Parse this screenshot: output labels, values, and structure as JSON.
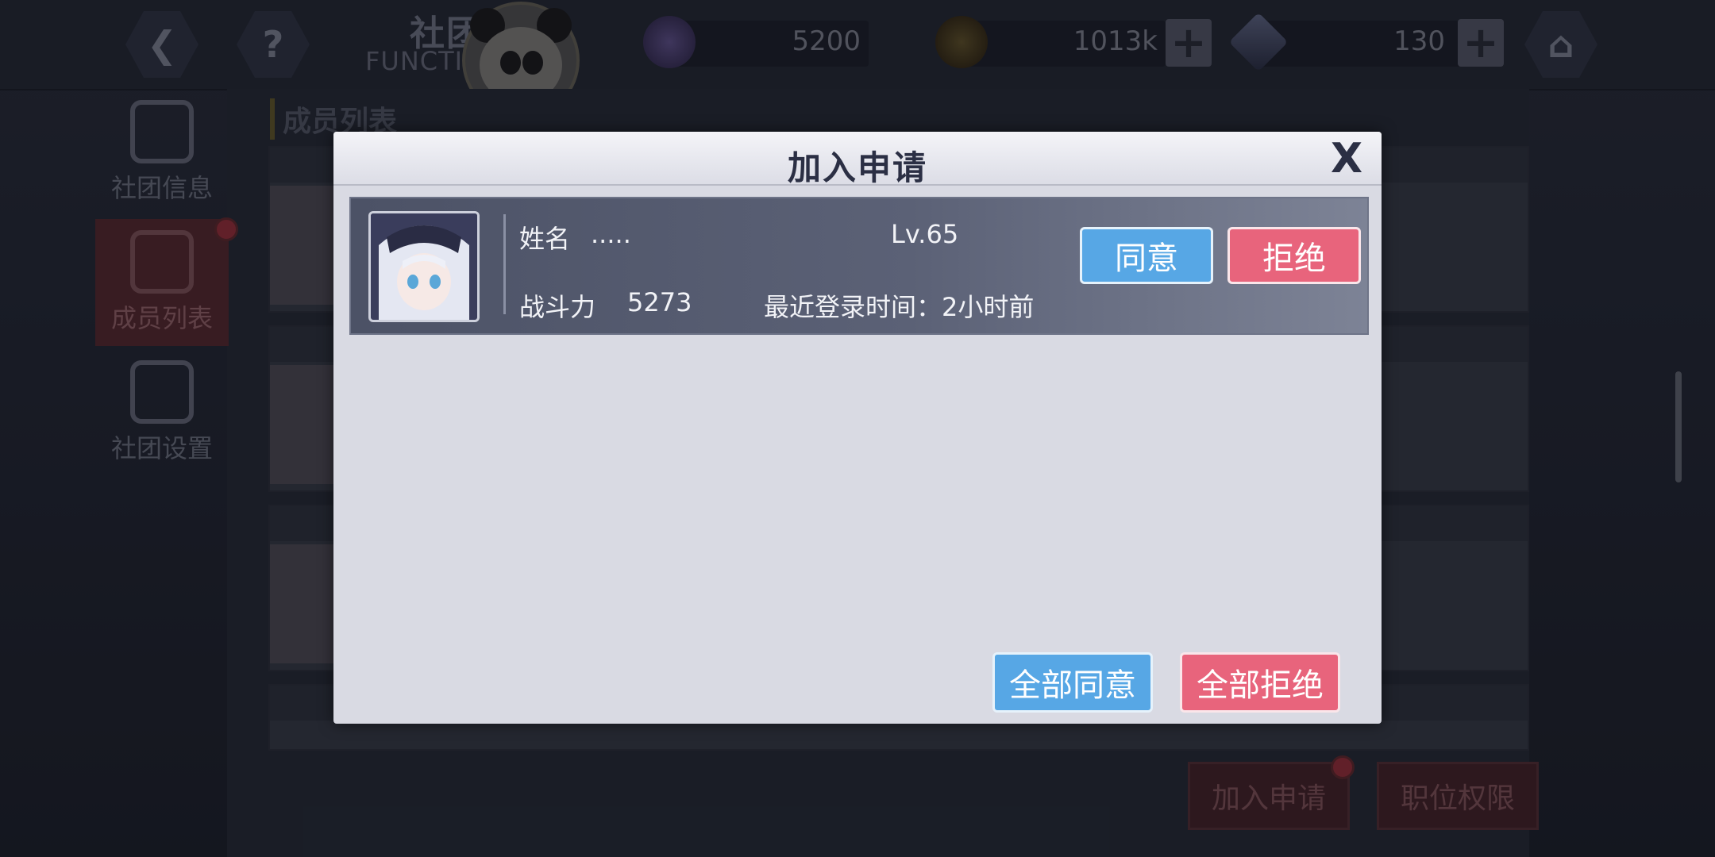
{
  "topbar": {
    "club_title": "社团",
    "club_subtitle": "FUNCTIONAL",
    "back_icon": "back-arrow-icon",
    "help_icon": "question-icon",
    "home_icon": "home-icon",
    "currencies": [
      {
        "name": "token-icon",
        "value": "5200"
      },
      {
        "name": "gold-coin-icon",
        "value": "1013k"
      },
      {
        "name": "crystal-icon",
        "value": "130"
      }
    ]
  },
  "sidebar": {
    "items": [
      {
        "label": "社团信息"
      },
      {
        "label": "成员列表"
      },
      {
        "label": "社团设置"
      }
    ]
  },
  "content": {
    "section_title": "成员列表",
    "bottom_buttons": {
      "join_requests": "加入申请",
      "permissions": "职位权限"
    }
  },
  "modal": {
    "title": "加入申请",
    "close_label": "X",
    "request": {
      "name_label": "姓名",
      "name_value": ".....",
      "level": "Lv.65",
      "power_label": "战斗力",
      "power_value": "5273",
      "last_login": "最近登录时间：2小时前",
      "accept_label": "同意",
      "reject_label": "拒绝"
    },
    "accept_all_label": "全部同意",
    "reject_all_label": "全部拒绝"
  },
  "colors": {
    "accept": "#57a7e5",
    "reject": "#e8647c",
    "modal_bg": "#d9dae3",
    "row_bg": "#4c5266"
  }
}
